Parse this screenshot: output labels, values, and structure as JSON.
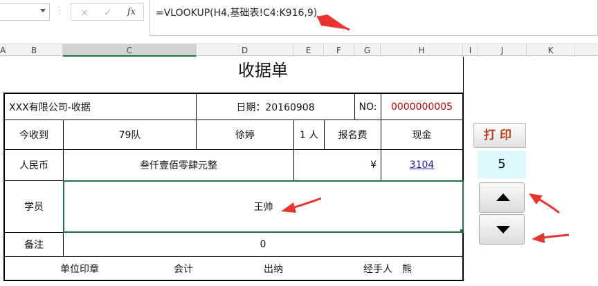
{
  "formula_bar": {
    "cancel_icon": "×",
    "confirm_icon": "✓",
    "fx_label": "fx",
    "formula": "=VLOOKUP(H4,基础表!C4:K916,9)"
  },
  "columns": [
    "A",
    "B",
    "C",
    "D",
    "E",
    "F",
    "G",
    "H",
    "I",
    "J",
    "K"
  ],
  "selected_column": "C",
  "receipt": {
    "title": "收据单",
    "company": "XXX有限公司-收据",
    "date_label": "日期：20160908",
    "no_label": "NO:",
    "no_value": "0000000005",
    "received_label": "今收到",
    "received_value": "79队",
    "person": "徐婷",
    "people_count": "1 人",
    "fee_label": "报名费",
    "payment": "现金",
    "currency_label": "人民币",
    "amount_words": "叁仟壹佰零肆元整",
    "currency_symbol": "¥",
    "amount": "3104",
    "student_label": "学员",
    "student_name": "王帅",
    "remark_label": "备注",
    "remark_value": "0",
    "footer_seal": "单位印章",
    "footer_accountant": "会计",
    "footer_cashier": "出纳",
    "footer_handler": "经手人　熊"
  },
  "controls": {
    "print_label": "打印",
    "counter_value": "5"
  },
  "colors": {
    "accent_green": "#217346",
    "arrow_red": "#e8332e",
    "print_text": "#b53d1a",
    "counter_bg": "#dcf8f8",
    "no_value": "#c00000"
  }
}
